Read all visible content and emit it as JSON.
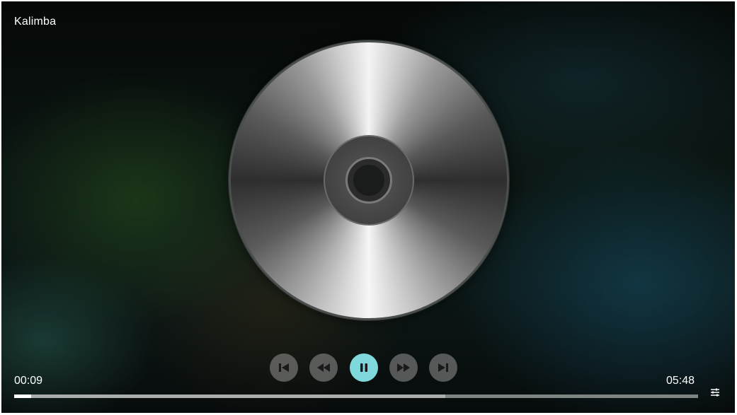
{
  "track": {
    "title": "Kalimba"
  },
  "playback": {
    "current_time": "00:09",
    "total_time": "05:48",
    "progress_fraction": 0.025,
    "buffered_fraction": 0.63,
    "state": "playing"
  },
  "controls": [
    {
      "name": "skip-previous-button",
      "icon": "skip-previous-icon"
    },
    {
      "name": "rewind-button",
      "icon": "rewind-icon"
    },
    {
      "name": "pause-button",
      "icon": "pause-icon"
    },
    {
      "name": "fast-forward-button",
      "icon": "fast-forward-icon"
    },
    {
      "name": "skip-next-button",
      "icon": "skip-next-icon"
    }
  ],
  "settings": {
    "icon": "equalizer-settings-icon"
  },
  "colors": {
    "accent": "#7fd8dc",
    "control_bg": "#969696",
    "text": "#ffffff",
    "progress_played": "#ffffff",
    "progress_buffered": "#a9adab",
    "progress_track": "#7e8482"
  },
  "album_art": {
    "icon": "compact-disc-icon"
  }
}
